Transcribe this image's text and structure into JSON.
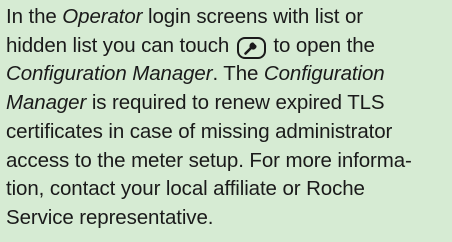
{
  "note": {
    "l1_pre": "In the ",
    "l1_em": "Operator",
    "l1_post": " login screens with list or",
    "l2_pre": "hidden list you can touch ",
    "l2_post": " to open the",
    "l3_em": "Configuration Manager",
    "l3_mid": ". The ",
    "l3_em2": "Configuration",
    "l4_em": "Manager",
    "l4_post": " is required to renew expired TLS",
    "l5": "certificates in case of missing administrator",
    "l6": "access to the meter setup. For more informa-",
    "l7": "tion, contact your local affiliate or Roche",
    "l8": "Service representative.",
    "icon": "wrench-icon"
  }
}
